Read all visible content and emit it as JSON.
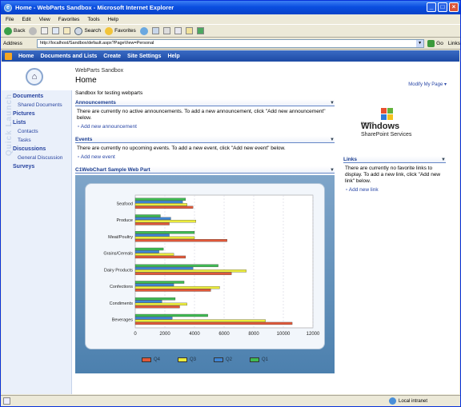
{
  "window": {
    "title": "Home - WebParts Sandbox - Microsoft Internet Explorer"
  },
  "menu": [
    "File",
    "Edit",
    "View",
    "Favorites",
    "Tools",
    "Help"
  ],
  "toolbar": {
    "back": "Back",
    "search": "Search",
    "favorites": "Favorites"
  },
  "address": {
    "label": "Address",
    "url": "http://localhost/Sandbox/default.aspx?PageView=Personal",
    "go": "Go",
    "links": "Links"
  },
  "spnav": [
    "Home",
    "Documents and Lists",
    "Create",
    "Site Settings",
    "Help"
  ],
  "site": {
    "name": "WebParts Sandbox",
    "title": "Home",
    "modify": "Modify My Page ▾"
  },
  "quicklaunch": {
    "watermark": "Quick Launch",
    "sections": [
      {
        "label": "Documents",
        "items": [
          "Shared Documents"
        ]
      },
      {
        "label": "Pictures",
        "items": []
      },
      {
        "label": "Lists",
        "items": [
          "Contacts",
          "Tasks"
        ]
      },
      {
        "label": "Discussions",
        "items": [
          "General Discussion"
        ]
      },
      {
        "label": "Surveys",
        "items": []
      }
    ]
  },
  "main": {
    "intro": "Sandbox for testing webparts",
    "announcements": {
      "title": "Announcements",
      "body": "There are currently no active announcements. To add a new announcement, click \"Add new announcement\" below.",
      "add": "Add new announcement"
    },
    "events": {
      "title": "Events",
      "body": "There are currently no upcoming events. To add a new event, click \"Add new event\" below.",
      "add": "Add new event"
    },
    "chart_title": "C1WebChart Sample Web Part"
  },
  "right": {
    "logo_ms": "Microsoft",
    "logo_windows": "Windows",
    "logo_sps": "SharePoint Services",
    "links_title": "Links",
    "links_body": "There are currently no favorite links to display. To add a new link, click \"Add new link\" below.",
    "links_add": "Add new link"
  },
  "status": {
    "zone": "Local intranet"
  },
  "colors": {
    "q1": "#3fba52",
    "q2": "#3f86d6",
    "q3": "#ecec3c",
    "q4": "#e0593a"
  },
  "chart_data": {
    "type": "bar",
    "orientation": "horizontal",
    "categories": [
      "Seafood",
      "Produce",
      "Meat/Poultry",
      "Grains/Cereals",
      "Dairy Products",
      "Confections",
      "Condiments",
      "Beverages"
    ],
    "series": [
      {
        "name": "Q1",
        "values": [
          3400,
          1700,
          4000,
          1900,
          5600,
          3300,
          2700,
          4900
        ]
      },
      {
        "name": "Q2",
        "values": [
          3200,
          2400,
          2300,
          1600,
          3900,
          2600,
          1800,
          2500
        ]
      },
      {
        "name": "Q3",
        "values": [
          3500,
          4100,
          4000,
          2600,
          7500,
          5700,
          3500,
          8800
        ]
      },
      {
        "name": "Q4",
        "values": [
          3900,
          2300,
          6200,
          3400,
          6500,
          5100,
          3000,
          10600
        ]
      }
    ],
    "xticks": [
      "0",
      "2000",
      "4000",
      "6000",
      "8000",
      "10000",
      "12000"
    ],
    "xlim": [
      0,
      12000
    ],
    "legend": [
      "Q4",
      "Q3",
      "Q2",
      "Q1"
    ],
    "grid": true
  }
}
